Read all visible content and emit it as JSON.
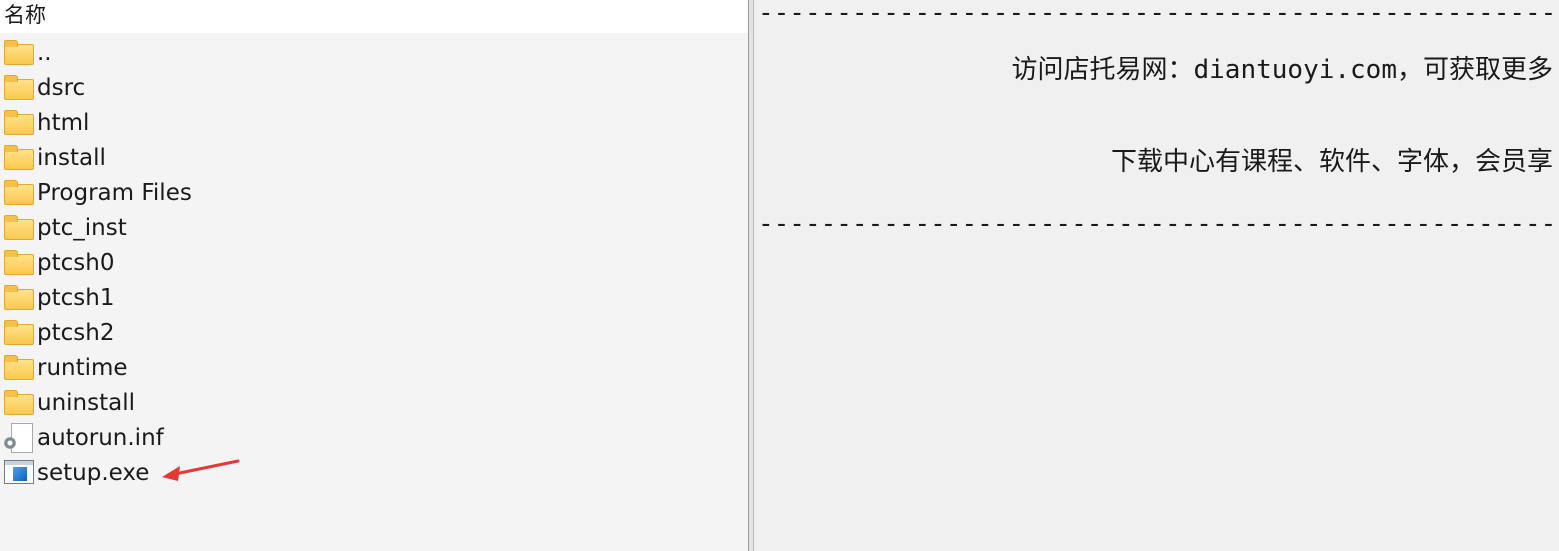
{
  "file_list": {
    "column_header": "名称",
    "items": [
      {
        "name": "..",
        "type": "folder"
      },
      {
        "name": "dsrc",
        "type": "folder"
      },
      {
        "name": "html",
        "type": "folder"
      },
      {
        "name": "install",
        "type": "folder"
      },
      {
        "name": "Program Files",
        "type": "folder"
      },
      {
        "name": "ptc_inst",
        "type": "folder"
      },
      {
        "name": "ptcsh0",
        "type": "folder"
      },
      {
        "name": "ptcsh1",
        "type": "folder"
      },
      {
        "name": "ptcsh2",
        "type": "folder"
      },
      {
        "name": "runtime",
        "type": "folder"
      },
      {
        "name": "uninstall",
        "type": "folder"
      },
      {
        "name": "autorun.inf",
        "type": "inf-file"
      },
      {
        "name": "setup.exe",
        "type": "exe-file"
      }
    ],
    "annotation": {
      "icon": "red-arrow-icon",
      "color": "#e53935"
    }
  },
  "preview": {
    "dash_line": "------------------------------------------------------------",
    "line1": "访问店托易网：diantuoyi.com，可获取更多",
    "line2": "下载中心有课程、软件、字体，会员享"
  },
  "colors": {
    "folder": "#f9c94d",
    "pane_left_bg": "#f4f4f4",
    "pane_right_bg": "#f0f0f0"
  }
}
